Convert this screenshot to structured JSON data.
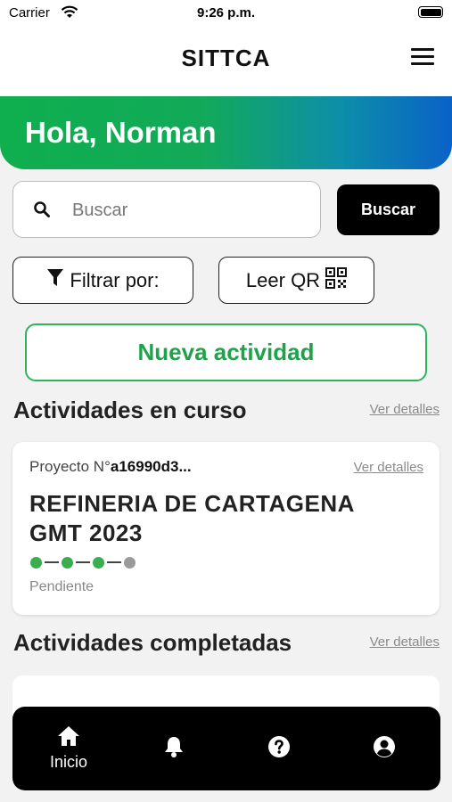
{
  "status_bar": {
    "carrier": "Carrier",
    "time": "9:26 p.m."
  },
  "header": {
    "title": "SITTCA"
  },
  "greeting": "Hola, Norman",
  "search": {
    "placeholder": "Buscar",
    "button_label": "Buscar"
  },
  "actions": {
    "filter_label": "Filtrar por:",
    "qr_label": "Leer QR",
    "new_activity_label": "Nueva actividad"
  },
  "in_progress": {
    "title": "Actividades en curso",
    "link": "Ver detalles",
    "card": {
      "project_prefix": "Proyecto N°",
      "project_id": "a16990d3...",
      "link": "Ver detalles",
      "name": "REFINERIA DE CARTAGENA GMT 2023",
      "steps_completed": 3,
      "steps_total": 4,
      "status": "Pendiente"
    }
  },
  "completed": {
    "title": "Actividades completadas",
    "link": "Ver detalles"
  },
  "tabbar": {
    "items": [
      {
        "icon": "home-icon",
        "label": "Inicio"
      },
      {
        "icon": "bell-icon",
        "label": ""
      },
      {
        "icon": "help-icon",
        "label": ""
      },
      {
        "icon": "profile-icon",
        "label": ""
      }
    ]
  },
  "colors": {
    "accent_green": "#1fa24a",
    "progress_green": "#3aad4e",
    "gradient_blue": "#0a62c8"
  }
}
